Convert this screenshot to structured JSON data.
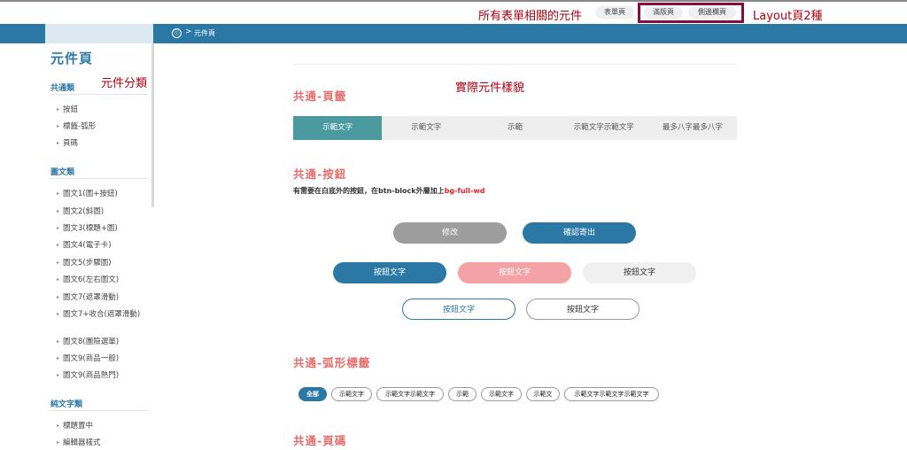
{
  "annotations": {
    "all_form_components": "所有表單相關的元件",
    "layout_two_kinds": "Layout頁2種",
    "component_category": "元件分類",
    "actual_component_look": "實際元件樣貌"
  },
  "topnav": {
    "form_page": "表單頁",
    "full_page": "滿版頁",
    "sidebar_page": "側邊欄頁"
  },
  "breadcrumb": {
    "current": "元件頁",
    "separator": ">",
    "home_icon": "ⓒ"
  },
  "sidebar": {
    "title": "元件頁",
    "sections": [
      {
        "heading": "共通類",
        "items": [
          "按鈕",
          "標籤-弧形",
          "頁碼"
        ]
      },
      {
        "heading": "圖文類",
        "items": [
          "圖文1(圖+按鈕)",
          "圖文2(斜圖)",
          "圖文3(標題+圖)",
          "圖文4(電子卡)",
          "圖文5(步驟圖)",
          "圖文6(左右圖文)",
          "圖文7(遮罩滑動)",
          "圖文7+收合(遮罩滑動)",
          "圖文8(團險選單)",
          "圖文9(商品一般)",
          "圖文9(商品熱門)"
        ]
      },
      {
        "heading": "純文字類",
        "items": [
          "標題置中",
          "編輯器樣式"
        ]
      }
    ]
  },
  "main": {
    "tabs_section": {
      "title": "共通-頁籤",
      "tabs": [
        "示範文字",
        "示範文字",
        "示範",
        "示範文字示範文字",
        "最多八字最多八字"
      ],
      "active_index": 0
    },
    "buttons_section": {
      "title": "共通-按鈕",
      "note_prefix": "有需要在白底外的按鈕，在btn-block外層加上",
      "note_class": "bg-full-wd",
      "buttons": {
        "edit": "修改",
        "confirm_send": "確認寄出",
        "btn_blue": "按鈕文字",
        "btn_pink": "按鈕文字",
        "btn_gray": "按鈕文字",
        "btn_outline_blue": "按鈕文字",
        "btn_outline_gray": "按鈕文字"
      }
    },
    "tags_section": {
      "title": "共通-弧形標籤",
      "tags": [
        "全部",
        "示範文字",
        "示範文字示範文字",
        "示範",
        "示範文字",
        "示範文",
        "示範文字示範文字示範文字"
      ]
    },
    "pagination_section": {
      "title": "共通-頁碼"
    }
  },
  "colors": {
    "brand_blue": "#2b78a5",
    "annotation_red": "#b00012",
    "section_title": "#e86b6b",
    "tab_active": "#4a9aa0"
  }
}
